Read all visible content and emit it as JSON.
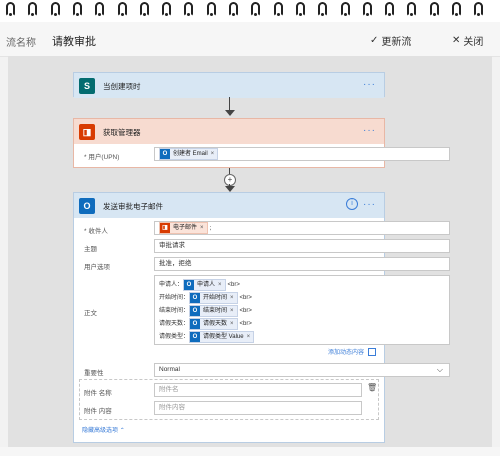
{
  "header": {
    "flow_label": "流名称",
    "flow_name": "请教审批",
    "update_button": "更新流",
    "update_icon": "checkmark-icon",
    "close_button": "关闭",
    "close_icon": "close-icon"
  },
  "colors": {
    "sharepoint": "#036c70",
    "office": "#d83b01",
    "outlook": "#0f6cbd",
    "link": "#3b7dd8"
  },
  "trigger": {
    "title": "当创建项时",
    "more": "···",
    "icon": "sharepoint-icon",
    "icon_letter": "S"
  },
  "manager": {
    "title": "获取管理器",
    "more": "···",
    "icon": "office-icon",
    "user_label": "* 用户(UPN)",
    "user_token": "创建者 Email",
    "token_close": "×"
  },
  "email": {
    "title": "发送审批电子邮件",
    "more": "···",
    "info_icon": "info-icon",
    "icon": "outlook-icon",
    "to_label": "* 收件人",
    "to_token": "电子邮件",
    "to_suffix": ";",
    "subject_label": "主题",
    "subject_value": "审批请求",
    "options_label": "用户选项",
    "options_value": "批准，拒绝",
    "body_label": "正文",
    "body_lines": [
      {
        "prefix": "申请人：",
        "token": "申请人",
        "suffix": "<br>"
      },
      {
        "prefix": "开始时间：",
        "token": "开始时间",
        "suffix": "<br>"
      },
      {
        "prefix": "结束时间：",
        "token": "结束时间",
        "suffix": "<br>"
      },
      {
        "prefix": "请假天数：",
        "token": "请假天数",
        "suffix": "<br>"
      },
      {
        "prefix": "请假类型：",
        "token": "请假类型 Value",
        "suffix": ""
      }
    ],
    "add_dynamic": "添加动态内容",
    "importance_label": "重要性",
    "importance_value": "Normal",
    "attach_name_label": "附件 名称",
    "attach_name_placeholder": "附件名",
    "attach_content_label": "附件 内容",
    "attach_content_placeholder": "附件内容",
    "hide_advanced": "隐藏高级选项"
  }
}
